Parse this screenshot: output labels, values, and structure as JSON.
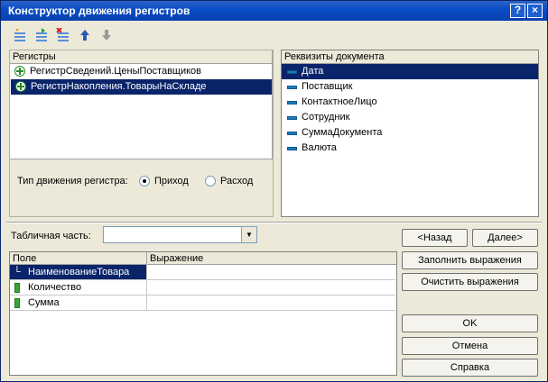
{
  "window": {
    "title": "Конструктор движения регистров",
    "help_glyph": "?",
    "close_glyph": "×"
  },
  "toolbar": {
    "icons": [
      "add-register-icon",
      "add-register-all-icon",
      "delete-register-icon",
      "move-up-icon",
      "move-down-icon"
    ]
  },
  "registers": {
    "header": "Регистры",
    "items": [
      {
        "label": "РегистрСведений.ЦеныПоставщиков",
        "selected": false
      },
      {
        "label": "РегистрНакопления.ТоварыНаСкладе",
        "selected": true
      }
    ]
  },
  "movement_type": {
    "label": "Тип движения регистра:",
    "options": [
      {
        "label": "Приход",
        "checked": true
      },
      {
        "label": "Расход",
        "checked": false
      }
    ]
  },
  "requisites": {
    "header": "Реквизиты документа",
    "items": [
      {
        "label": "Дата",
        "selected": true
      },
      {
        "label": "Поставщик",
        "selected": false
      },
      {
        "label": "КонтактноеЛицо",
        "selected": false
      },
      {
        "label": "Сотрудник",
        "selected": false
      },
      {
        "label": "СуммаДокумента",
        "selected": false
      },
      {
        "label": "Валюта",
        "selected": false
      }
    ]
  },
  "table_part": {
    "label": "Табличная часть:",
    "value": ""
  },
  "grid": {
    "columns": [
      "Поле",
      "Выражение"
    ],
    "rows": [
      {
        "field": "НаименованиеТовара",
        "expression": "",
        "selected": true
      },
      {
        "field": "Количество",
        "expression": "",
        "selected": false
      },
      {
        "field": "Сумма",
        "expression": "",
        "selected": false
      }
    ]
  },
  "buttons": {
    "back": "<Назад",
    "next": "Далее>",
    "fill": "Заполнить выражения",
    "clear": "Очистить выражения",
    "ok": "OK",
    "cancel": "Отмена",
    "help": "Справка"
  }
}
